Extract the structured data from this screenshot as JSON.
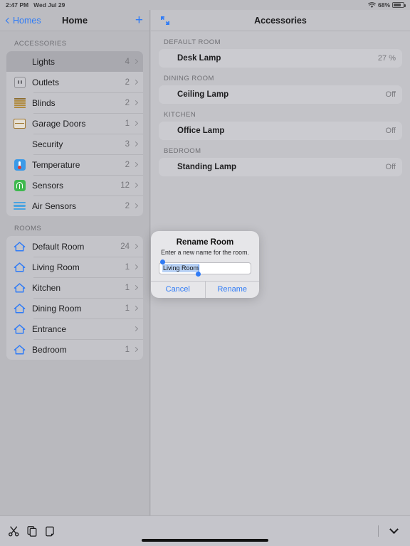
{
  "status_bar": {
    "time": "2:47 PM",
    "date": "Wed Jul 29",
    "battery_percent": "68%",
    "wifi_icon": "wifi-icon",
    "battery_icon": "battery-icon"
  },
  "sidebar": {
    "back_label": "Homes",
    "title": "Home",
    "add_label": "+",
    "sections": [
      {
        "header": "ACCESSORIES",
        "items": [
          {
            "label": "Lights",
            "count": "4",
            "icon": "lightbulb-icon",
            "selected": true
          },
          {
            "label": "Outlets",
            "count": "2",
            "icon": "outlet-icon",
            "selected": false
          },
          {
            "label": "Blinds",
            "count": "2",
            "icon": "blinds-icon",
            "selected": false
          },
          {
            "label": "Garage Doors",
            "count": "1",
            "icon": "garage-door-icon",
            "selected": false
          },
          {
            "label": "Security",
            "count": "3",
            "icon": "siren-icon",
            "selected": false
          },
          {
            "label": "Temperature",
            "count": "2",
            "icon": "thermometer-icon",
            "selected": false
          },
          {
            "label": "Sensors",
            "count": "12",
            "icon": "sensor-icon",
            "selected": false
          },
          {
            "label": "Air Sensors",
            "count": "2",
            "icon": "air-waves-icon",
            "selected": false
          }
        ]
      },
      {
        "header": "ROOMS",
        "items": [
          {
            "label": "Default Room",
            "count": "24",
            "icon": "house-icon",
            "selected": false
          },
          {
            "label": "Living Room",
            "count": "1",
            "icon": "house-icon",
            "selected": false
          },
          {
            "label": "Kitchen",
            "count": "1",
            "icon": "house-icon",
            "selected": false
          },
          {
            "label": "Dining Room",
            "count": "1",
            "icon": "house-icon",
            "selected": false
          },
          {
            "label": "Entrance",
            "count": "",
            "icon": "house-icon",
            "selected": false
          },
          {
            "label": "Bedroom",
            "count": "1",
            "icon": "house-icon",
            "selected": false
          }
        ]
      }
    ]
  },
  "detail": {
    "title": "Accessories",
    "expand_icon": "expand-arrows-icon",
    "groups": [
      {
        "header": "DEFAULT ROOM",
        "accessories": [
          {
            "name": "Desk Lamp",
            "state": "27 %",
            "icon": "lightbulb-icon",
            "on": true
          }
        ]
      },
      {
        "header": "DINING ROOM",
        "accessories": [
          {
            "name": "Ceiling Lamp",
            "state": "Off",
            "icon": "lightbulb-icon",
            "on": false
          }
        ]
      },
      {
        "header": "KITCHEN",
        "accessories": [
          {
            "name": "Office Lamp",
            "state": "Off",
            "icon": "lightbulb-icon",
            "on": false
          }
        ]
      },
      {
        "header": "BEDROOM",
        "accessories": [
          {
            "name": "Standing Lamp",
            "state": "Off",
            "icon": "lightbulb-icon",
            "on": false
          }
        ]
      }
    ]
  },
  "modal": {
    "title": "Rename Room",
    "message": "Enter a new name for the room.",
    "input_value": "Living Room",
    "input_selected": true,
    "cancel_label": "Cancel",
    "confirm_label": "Rename"
  },
  "toolbar": {
    "cut_icon": "scissors-icon",
    "copy_icon": "copy-icon",
    "paste_icon": "paste-icon",
    "dismiss_icon": "chevron-down-icon"
  },
  "colors": {
    "accent_blue": "#2f7bf6",
    "bulb_on_yellow": "#e8b800",
    "bulb_off_gray": "#9a9a9f",
    "selection_blue": "#b9d2f5"
  }
}
